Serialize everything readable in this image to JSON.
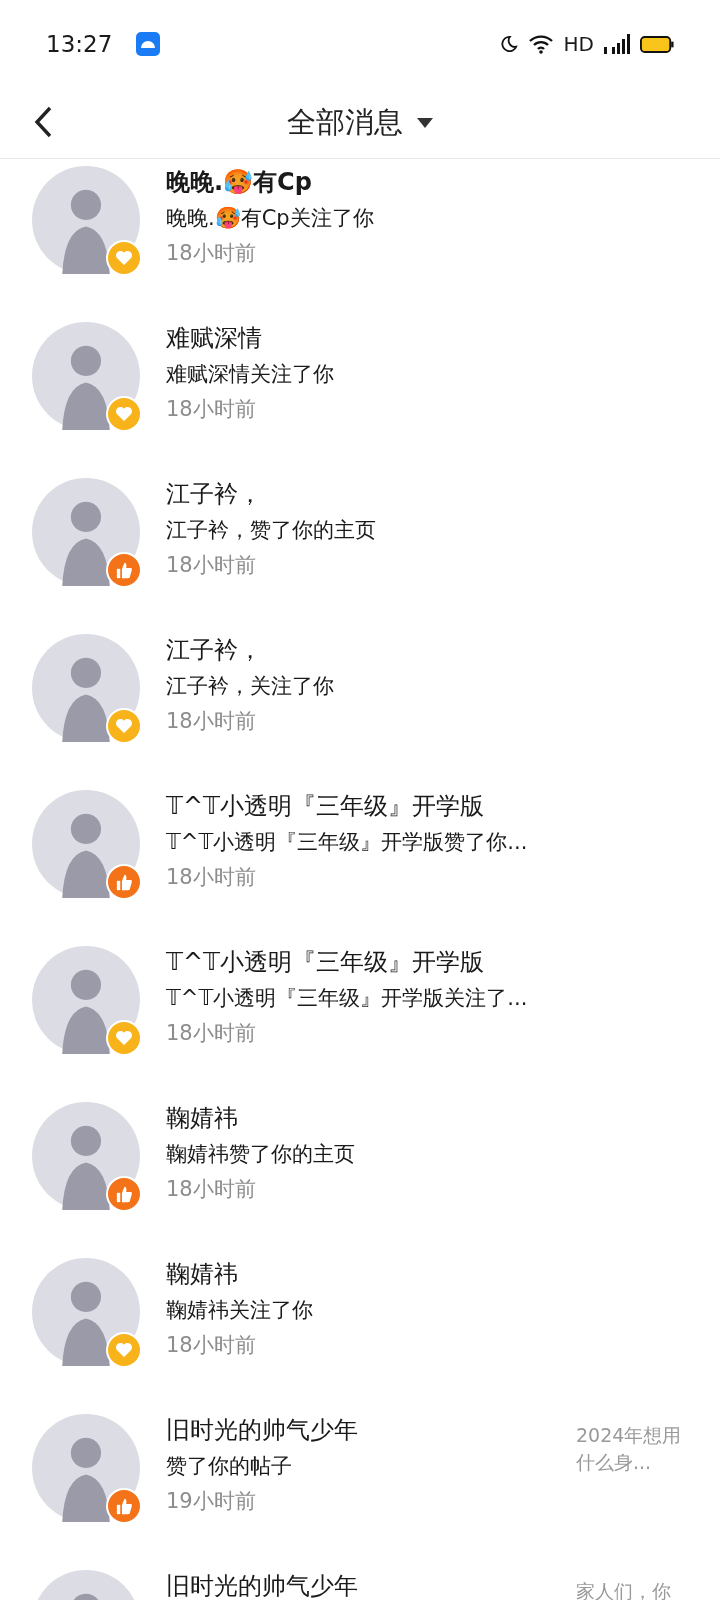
{
  "status_bar": {
    "time": "13:27",
    "network": "HD"
  },
  "header": {
    "title": "全部消息"
  },
  "messages": [
    {
      "name": "晚晚.🥵有Cp",
      "bold": true,
      "text": "晚晚.🥵有Cp关注了你",
      "time": "18小时前",
      "kind": "follow"
    },
    {
      "name": "难赋深情",
      "bold": false,
      "text": "难赋深情关注了你",
      "time": "18小时前",
      "kind": "follow"
    },
    {
      "name": "江子衿，",
      "bold": false,
      "text": "江子衿，赞了你的主页",
      "time": "18小时前",
      "kind": "like"
    },
    {
      "name": "江子衿，",
      "bold": false,
      "text": "江子衿，关注了你",
      "time": "18小时前",
      "kind": "follow"
    },
    {
      "name": "𝕋^𝕋小透明『三年级』开学版",
      "bold": false,
      "text": "𝕋^𝕋小透明『三年级』开学版赞了你...",
      "time": "18小时前",
      "kind": "like"
    },
    {
      "name": "𝕋^𝕋小透明『三年级』开学版",
      "bold": false,
      "text": "𝕋^𝕋小透明『三年级』开学版关注了...",
      "time": "18小时前",
      "kind": "follow"
    },
    {
      "name": "鞠婧祎",
      "bold": false,
      "text": "鞠婧祎赞了你的主页",
      "time": "18小时前",
      "kind": "like"
    },
    {
      "name": "鞠婧祎",
      "bold": false,
      "text": "鞠婧祎关注了你",
      "time": "18小时前",
      "kind": "follow"
    },
    {
      "name": "旧时光的帅气少年",
      "bold": false,
      "text": "赞了你的帖子",
      "time": "19小时前",
      "kind": "like",
      "post": "2024年想用什么身..."
    },
    {
      "name": "旧时光的帅气少年",
      "bold": false,
      "post": "家人们，你"
    }
  ]
}
